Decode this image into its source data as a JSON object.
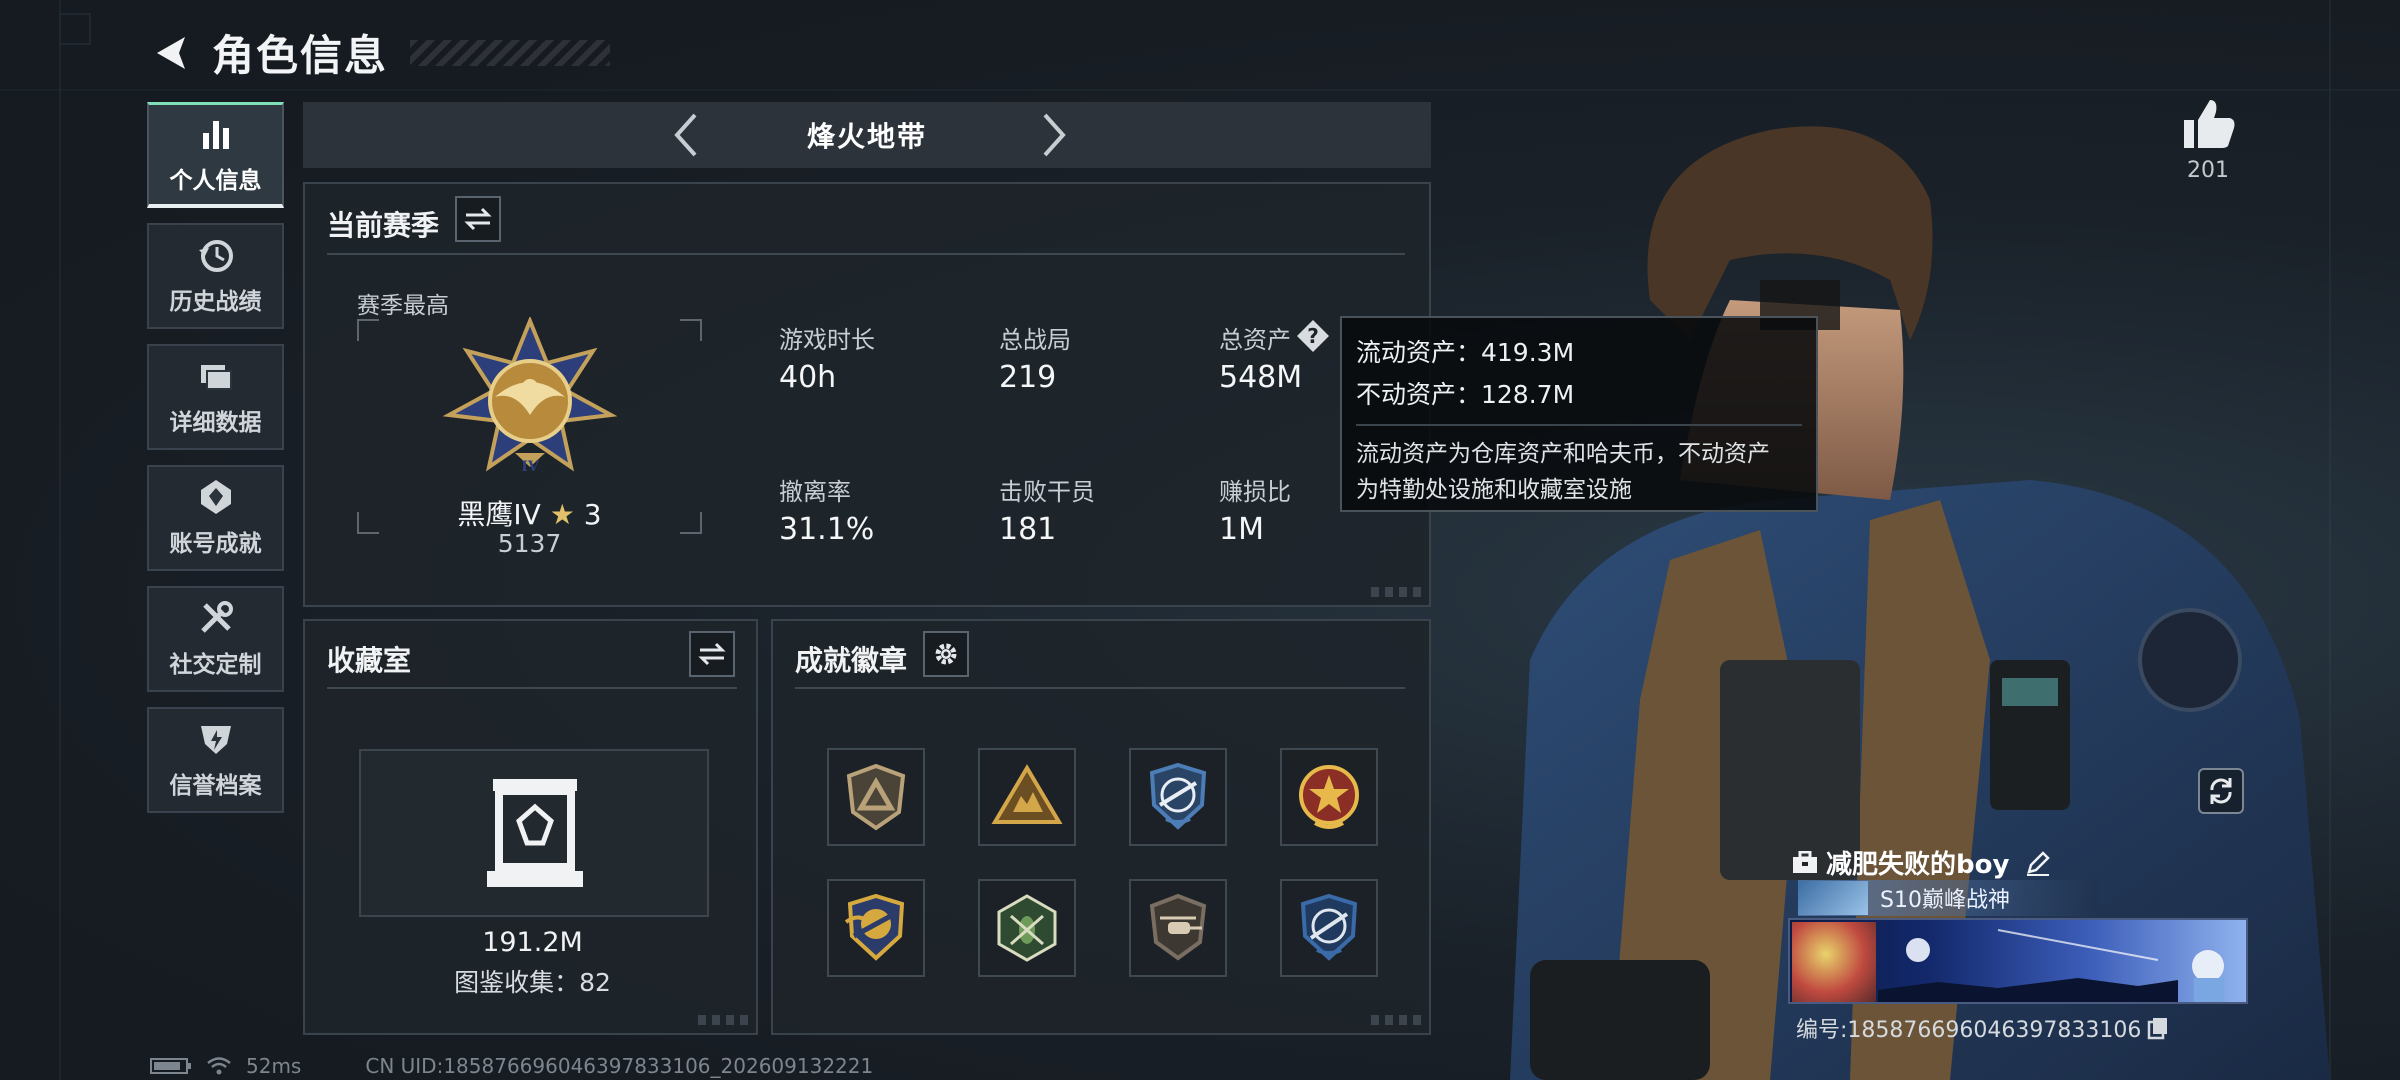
{
  "header": {
    "title": "角色信息"
  },
  "sidebar": {
    "items": [
      {
        "label": "个人信息",
        "icon": "bar-chart-icon",
        "active": true
      },
      {
        "label": "历史战绩",
        "icon": "history-clock-icon"
      },
      {
        "label": "详细数据",
        "icon": "folder-icon"
      },
      {
        "label": "账号成就",
        "icon": "achievement-icon"
      },
      {
        "label": "社交定制",
        "icon": "tools-icon"
      },
      {
        "label": "信誉档案",
        "icon": "credit-icon"
      }
    ]
  },
  "mode_bar": {
    "title": "烽火地带"
  },
  "season": {
    "title": "当前赛季",
    "best_label": "赛季最高",
    "rank_name": "黑鹰IV",
    "rank_stars": "3",
    "rank_score": "5137",
    "stats": [
      {
        "label": "游戏时长",
        "value": "40h"
      },
      {
        "label": "总战局",
        "value": "219"
      },
      {
        "label": "总资产",
        "value": "548M"
      },
      {
        "label": "撤离率",
        "value": "31.1%"
      },
      {
        "label": "击败干员",
        "value": "181"
      },
      {
        "label": "赚损比",
        "value": "1M"
      }
    ]
  },
  "tooltip": {
    "line1": "流动资产：419.3M",
    "line2": "不动资产：128.7M",
    "desc_line1": "流动资产为仓库资产和哈夫币，不动资产",
    "desc_line2": "为特勤处设施和收藏室设施"
  },
  "collection": {
    "title": "收藏室",
    "value": "191.2M",
    "catalog": "图鉴收集：82"
  },
  "achievements": {
    "title": "成就徽章",
    "badges": [
      {
        "icon": "shield-badge-icon",
        "colors": [
          "#b9a27a",
          "#4a4438"
        ]
      },
      {
        "icon": "warning-triangle-badge-icon",
        "colors": [
          "#d4a64a",
          "#6b4e22"
        ]
      },
      {
        "icon": "blue-wing-badge-icon",
        "colors": [
          "#4c7db6",
          "#e8eef4"
        ]
      },
      {
        "icon": "red-star-badge-icon",
        "colors": [
          "#c0503a",
          "#e6b94a"
        ]
      },
      {
        "icon": "gold-wing-badge-icon",
        "colors": [
          "#d6a93e",
          "#2c3c6a"
        ]
      },
      {
        "icon": "green-insect-badge-icon",
        "colors": [
          "#6e9a5a",
          "#d8dcc0"
        ]
      },
      {
        "icon": "helicopter-badge-icon",
        "colors": [
          "#7a6e62",
          "#d8cbb4"
        ]
      },
      {
        "icon": "blue-wing-badge-2-icon",
        "colors": [
          "#3a6aa8",
          "#dfe6ee"
        ]
      }
    ]
  },
  "likes": {
    "count": "201"
  },
  "player": {
    "name": "减肥失败的boy",
    "title": "S10巅峰战神",
    "id": "编号:1858766960463978331​06"
  },
  "status_bar": {
    "ping": "52ms",
    "uid": "CN UID:1858766960463978331​06_202609132221"
  }
}
